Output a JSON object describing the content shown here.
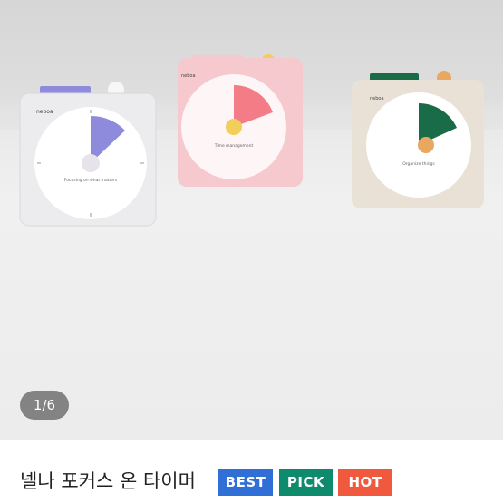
{
  "gallery": {
    "counter": "1/6",
    "timers": [
      {
        "brand": "neboa",
        "dial_caption": "Focusing on what matters",
        "accent_color": "#8f8bdc",
        "body_color": "#ececef",
        "knob_color": "#e6e4ea"
      },
      {
        "brand": "neboa",
        "dial_caption": "Time management",
        "accent_color": "#f47c86",
        "body_color": "#f6c9ce",
        "knob_color": "#f2cf5a"
      },
      {
        "brand": "neboa",
        "dial_caption": "Organize things",
        "accent_color": "#1a6b47",
        "body_color": "#e9e1d6",
        "knob_color": "#e8a860"
      }
    ]
  },
  "product": {
    "title": "넬나 포커스 온 타이머",
    "badges": [
      {
        "label": "BEST",
        "color": "#2f6fd6"
      },
      {
        "label": "PICK",
        "color": "#0e8a6c"
      },
      {
        "label": "HOT",
        "color": "#f0593d"
      }
    ]
  }
}
